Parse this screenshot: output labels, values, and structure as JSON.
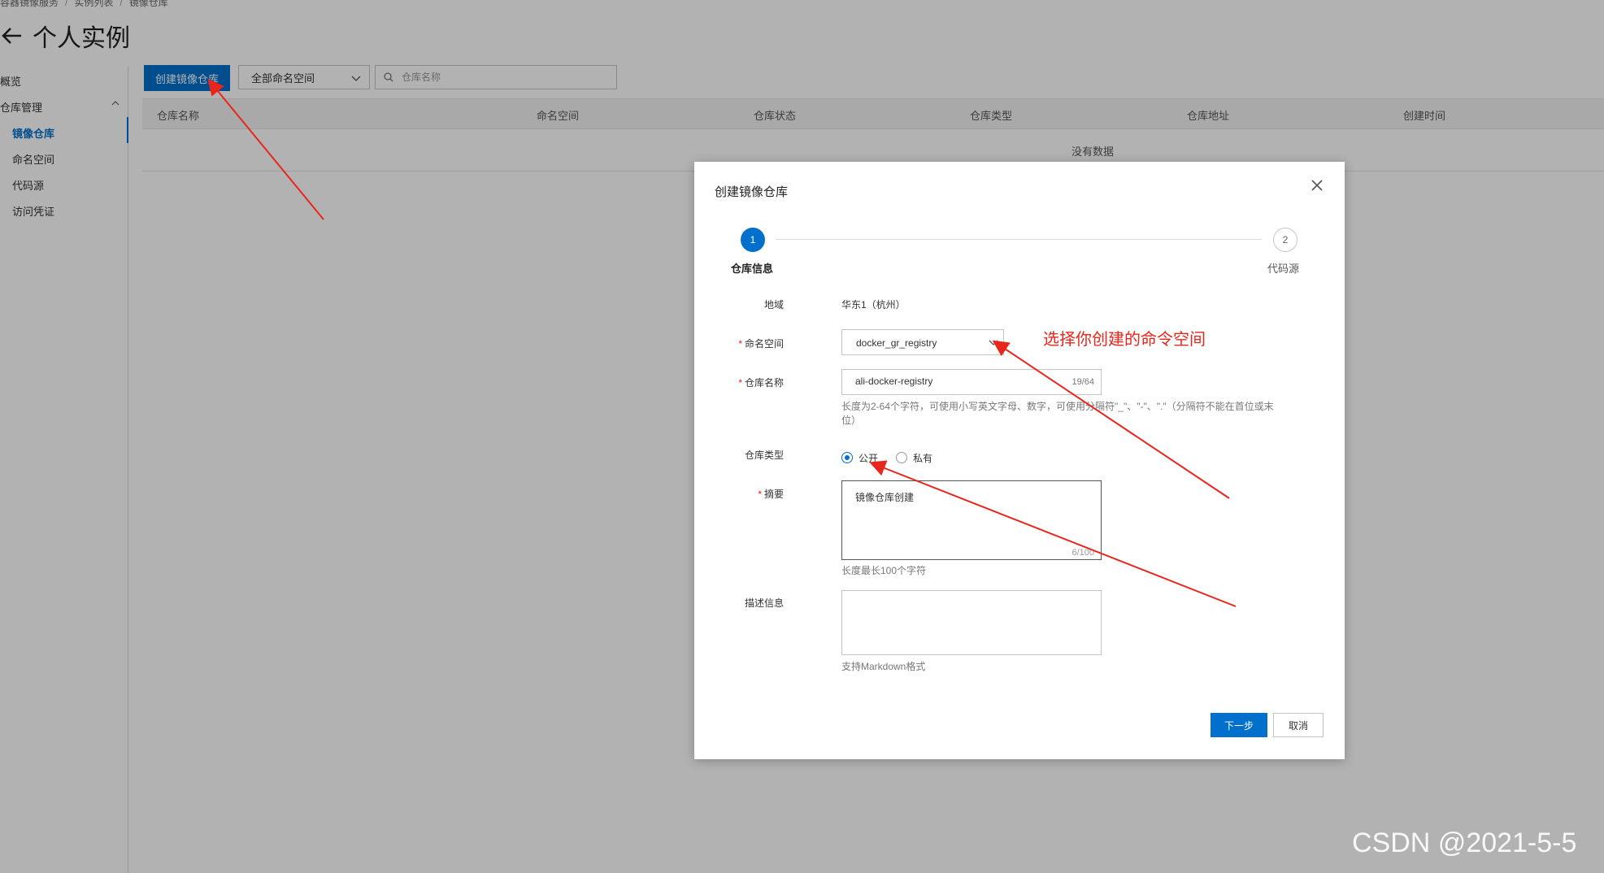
{
  "breadcrumb": [
    "容器镜像服务",
    "实例列表",
    "镜像仓库"
  ],
  "page": {
    "title": "个人实例"
  },
  "sidebar": {
    "items": [
      {
        "label": "概览"
      },
      {
        "label": "仓库管理"
      },
      {
        "label": "镜像仓库"
      },
      {
        "label": "命名空间"
      },
      {
        "label": "代码源"
      },
      {
        "label": "访问凭证"
      }
    ]
  },
  "toolbar": {
    "create_label": "创建镜像仓库",
    "namespace_filter": "全部命名空间",
    "search_placeholder": "仓库名称"
  },
  "table": {
    "columns": [
      "仓库名称",
      "命名空间",
      "仓库状态",
      "仓库类型",
      "仓库地址",
      "创建时间"
    ],
    "empty_text": "没有数据"
  },
  "dialog": {
    "title": "创建镜像仓库",
    "steps": [
      {
        "number": "1",
        "label": "仓库信息"
      },
      {
        "number": "2",
        "label": "代码源"
      }
    ],
    "fields": {
      "region": {
        "label": "地域",
        "value": "华东1（杭州）"
      },
      "namespace": {
        "label": "命名空间",
        "value": "docker_gr_registry"
      },
      "repo_name": {
        "label": "仓库名称",
        "value": "ali-docker-registry",
        "count": "19/64",
        "hint": "长度为2-64个字符，可使用小写英文字母、数字，可使用分隔符\"_\"、\"-\"、\".\"（分隔符不能在首位或末位）"
      },
      "repo_type": {
        "label": "仓库类型",
        "options": [
          "公开",
          "私有"
        ],
        "selected": "公开"
      },
      "summary": {
        "label": "摘要",
        "value": "镜像仓库创建",
        "count": "6/100",
        "hint": "长度最长100个字符"
      },
      "description": {
        "label": "描述信息",
        "hint": "支持Markdown格式"
      }
    },
    "next_label": "下一步",
    "cancel_label": "取消"
  },
  "annotation": {
    "text": "选择你创建的命令空间",
    "color": "#e8261c"
  },
  "watermark": "CSDN @2021-5-5",
  "colors": {
    "primary": "#0070cc",
    "annotation": "#e8261c",
    "required": "#e02020"
  }
}
